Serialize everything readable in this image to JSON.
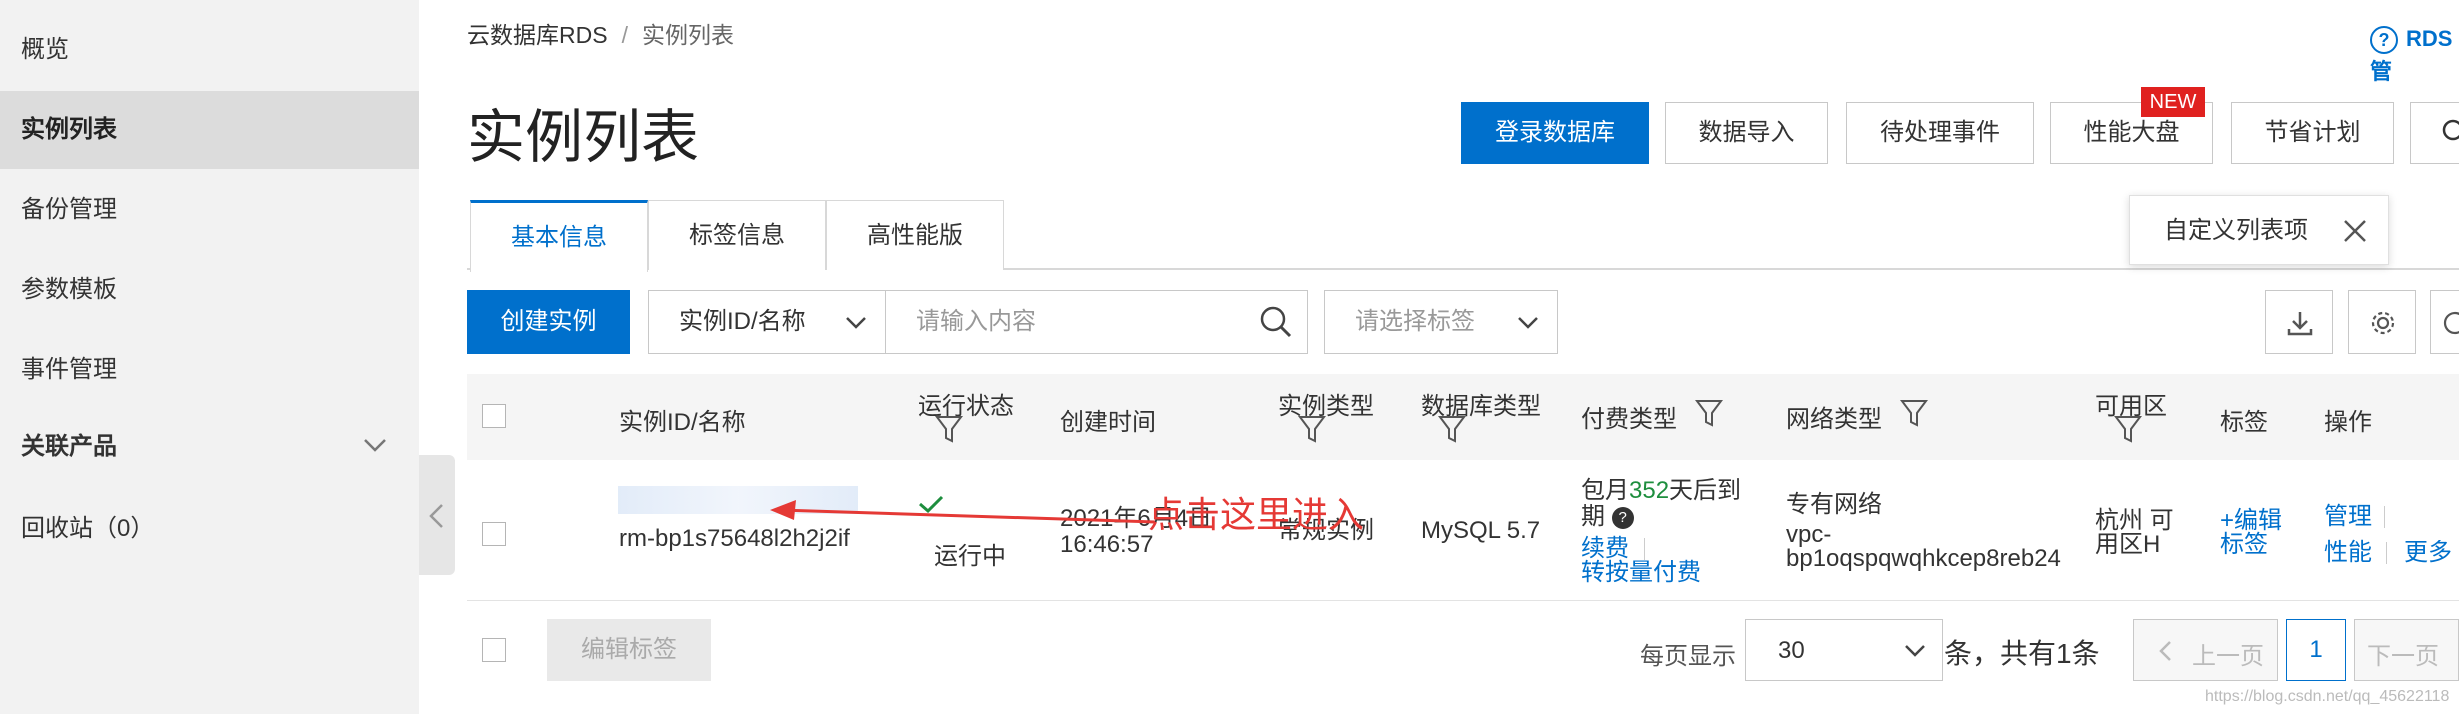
{
  "sidebar": {
    "items": [
      {
        "label": "概览"
      },
      {
        "label": "实例列表"
      },
      {
        "label": "备份管理"
      },
      {
        "label": "参数模板"
      },
      {
        "label": "事件管理"
      },
      {
        "label": "关联产品"
      },
      {
        "label": "回收站（0）"
      }
    ]
  },
  "breadcrumb": {
    "root": "云数据库RDS",
    "sep": "/",
    "current": "实例列表"
  },
  "help": {
    "label": "RDS管"
  },
  "page": {
    "title": "实例列表"
  },
  "header_buttons": {
    "login": "登录数据库",
    "import": "数据导入",
    "pending": "待处理事件",
    "performance": "性能大盘",
    "new_badge": "NEW",
    "savings": "节省计划"
  },
  "tabs": [
    {
      "label": "基本信息"
    },
    {
      "label": "标签信息"
    },
    {
      "label": "高性能版"
    }
  ],
  "popover": {
    "label": "自定义列表项"
  },
  "toolbar": {
    "create": "创建实例",
    "search_type": "实例ID/名称",
    "search_placeholder": "请输入内容",
    "tag_placeholder": "请选择标签"
  },
  "table": {
    "headers": {
      "id_name": "实例ID/名称",
      "status": "运行状态",
      "created": "创建时间",
      "instance_type": "实例类型",
      "db_type": "数据库类型",
      "billing": "付费类型",
      "network": "网络类型",
      "zone": "可用区",
      "tags": "标签",
      "actions": "操作"
    },
    "rows": [
      {
        "instance_id": "rm-bp1s75648l2h2j2if",
        "status": "运行中",
        "created_line1": "2021年6月4日",
        "created_line2": "16:46:57",
        "instance_type": "常规实例",
        "db_type": "MySQL 5.7",
        "billing_prefix": "包月",
        "billing_days": "352",
        "billing_suffix": "天后到",
        "billing_line2": "期",
        "renew": "续费",
        "convert": "转按量付费",
        "network_type": "专有网络",
        "network_vpc_1": "vpc-",
        "network_vpc_2": "bp1oqspqwqhkcep8reb24",
        "zone_line1": "杭州 可",
        "zone_line2": "用区H",
        "tag_edit_1": "+编辑",
        "tag_edit_2": "标签",
        "manage": "管理",
        "perf": "性能",
        "more": "更多"
      }
    ]
  },
  "annotation": {
    "text": "点击这里进入",
    "color": "#e53935"
  },
  "footer": {
    "edit_tags": "编辑标签",
    "per_page_label": "每页显示",
    "per_page_value": "30",
    "total": "条，共有1条",
    "prev": "上一页",
    "page": "1",
    "next": "下一页"
  },
  "watermark": "https://blog.csdn.net/qq_45622118",
  "colors": {
    "primary": "#0070cc",
    "badge": "#e0211f",
    "success": "#1e8e3e",
    "annotation": "#e53935"
  }
}
